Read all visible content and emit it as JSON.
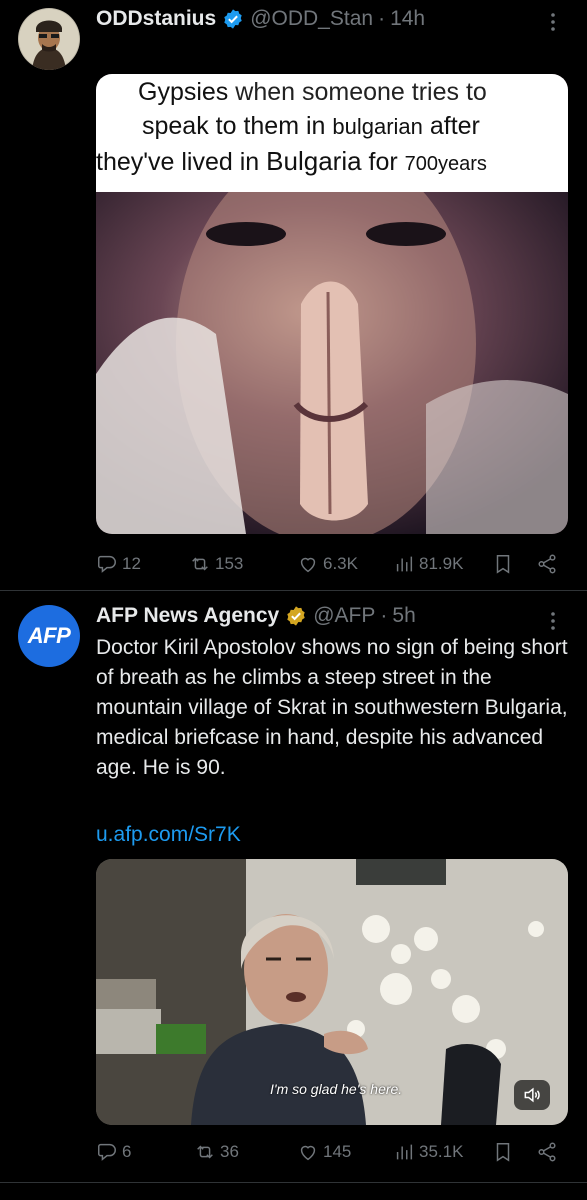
{
  "tweets": [
    {
      "author": "ODDstanius",
      "handle": "@ODD_Stan",
      "time": "14h",
      "meme": {
        "line1_a": "Gypsies",
        "line1_b": "when someone tries to",
        "line2_a": "speak to them in",
        "line2_b": "bulgarian",
        "line2_c": "after",
        "line3_a": "they've lived in",
        "line3_b": "Bulgaria",
        "line3_c": "for",
        "line3_d": "700years"
      },
      "stats": {
        "replies": "12",
        "retweets": "153",
        "likes": "6.3K",
        "views": "81.9K"
      }
    },
    {
      "author": "AFP News Agency",
      "handle": "@AFP",
      "time": "5h",
      "avatar_text": "AFP",
      "text": "Doctor Kiril Apostolov shows no sign of being short of breath as he climbs a steep street in the mountain village of Skrat in southwestern Bulgaria, medical briefcase in hand, despite his advanced age. He is 90.",
      "link": "u.afp.com/Sr7K",
      "video_caption": "I'm so glad he's here.",
      "stats": {
        "replies": "6",
        "retweets": "36",
        "likes": "145",
        "views": "35.1K"
      }
    }
  ],
  "colors": {
    "accent": "#1d9bf0",
    "muted": "#71767b",
    "text": "#e7e9ea",
    "background": "#000000",
    "divider": "#2f3336"
  }
}
